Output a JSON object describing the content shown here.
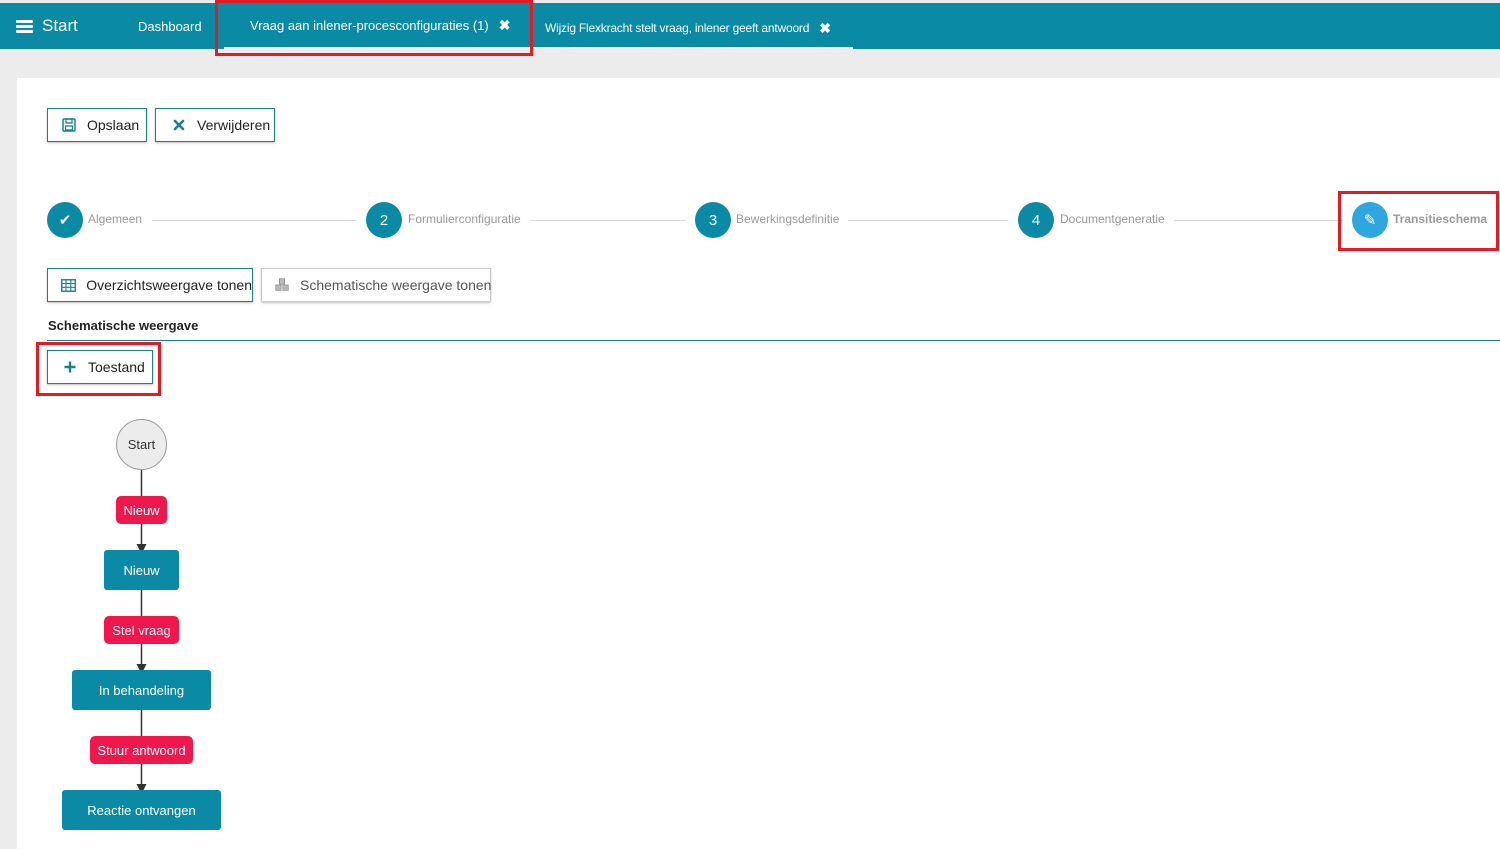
{
  "topbar": {
    "menu_label": "Start",
    "tabs": [
      {
        "label": "Dashboard"
      },
      {
        "label": "Vraag aan inlener-procesconfiguraties (1)",
        "close": "✖"
      },
      {
        "label": "Wijzig Flexkracht stelt vraag, inlener geeft antwoord",
        "close": "✖"
      }
    ]
  },
  "toolbar": {
    "save_label": "Opslaan",
    "delete_label": "Verwijderen"
  },
  "stepper": {
    "steps": [
      {
        "number": "✔",
        "label": "Algemeen",
        "status": "done"
      },
      {
        "number": "2",
        "label": "Formulierconfiguratie",
        "status": "todo"
      },
      {
        "number": "3",
        "label": "Bewerkingsdefinitie",
        "status": "todo"
      },
      {
        "number": "4",
        "label": "Documentgeneratie",
        "status": "todo"
      },
      {
        "number": "✎",
        "label": "Transitieschema",
        "status": "active"
      }
    ]
  },
  "views": {
    "overview_label": "Overzichtsweergave tonen",
    "schematic_label": "Schematische weergave tonen"
  },
  "section": {
    "title": "Schematische weergave",
    "add_state_label": "Toestand"
  },
  "diagram": {
    "start": "Start",
    "transitions": [
      "Nieuw",
      "Stel vraag",
      "Stuur antwoord"
    ],
    "states": [
      "Nieuw",
      "In behandeling",
      "Reactie ontvangen"
    ]
  },
  "colors": {
    "primary": "#0a8aa5",
    "active_step": "#2ea6e0",
    "transition": "#f0174c",
    "highlight": "#e31b23"
  }
}
